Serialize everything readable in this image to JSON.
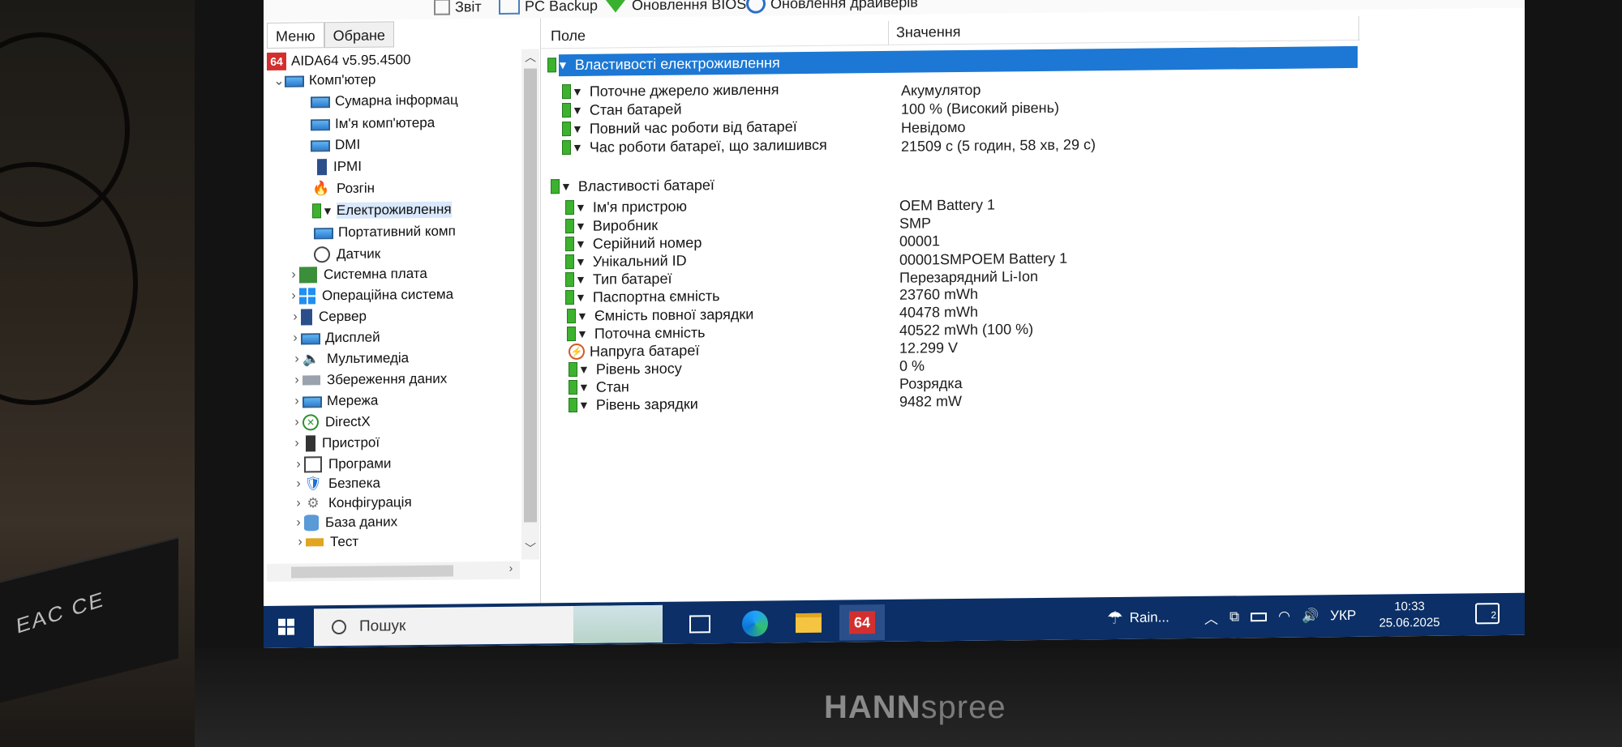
{
  "toolbar": {
    "report": "Звіт",
    "pc_backup": "PC Backup",
    "bios_update": "Оновлення BIOS",
    "driver_update": "Оновлення драйверів"
  },
  "left_pane": {
    "tabs": [
      "Меню",
      "Обране"
    ],
    "app_version": "AIDA64 v5.95.4500",
    "computer": "Комп'ютер",
    "computer_children": [
      "Сумарна інформац",
      "Ім'я комп'ютера",
      "DMI",
      "IPMI",
      "Розгін",
      "Електроживлення",
      "Портативний комп",
      "Датчик"
    ],
    "top_level": [
      "Системна плата",
      "Операційна система",
      "Сервер",
      "Дисплей",
      "Мультимедіа",
      "Збереження даних",
      "Мережа",
      "DirectX",
      "Пристрої",
      "Програми",
      "Безпека",
      "Конфігурація",
      "База даних",
      "Тест"
    ],
    "selected": "Електроживлення"
  },
  "right_pane": {
    "col_field": "Поле",
    "col_value": "Значення",
    "power_section": "Властивості електроживлення",
    "power_rows": [
      {
        "field": "Поточне джерело живлення",
        "value": "Акумулятор"
      },
      {
        "field": "Стан батарей",
        "value": "100 % (Високий рівень)"
      },
      {
        "field": "Повний час роботи від батареї",
        "value": "Невідомо"
      },
      {
        "field": "Час роботи батареї, що залишився",
        "value": "21509 с (5 годин, 58 хв, 29 с)"
      }
    ],
    "battery_section": "Властивості батареї",
    "battery_rows": [
      {
        "field": "Ім'я пристрою",
        "value": "OEM Battery 1"
      },
      {
        "field": "Виробник",
        "value": "SMP"
      },
      {
        "field": "Серійний номер",
        "value": "00001"
      },
      {
        "field": "Унікальний ID",
        "value": "00001SMPOEM Battery 1"
      },
      {
        "field": "Тип батареї",
        "value": "Перезарядний Li-Ion"
      },
      {
        "field": "Паспортна ємність",
        "value": "23760 mWh"
      },
      {
        "field": "Ємність повної зарядки",
        "value": "40478 mWh"
      },
      {
        "field": "Поточна ємність",
        "value": "40522 mWh  (100 %)"
      },
      {
        "field": "Напруга батареї",
        "value": "12.299 V"
      },
      {
        "field": "Рівень зносу",
        "value": "0 %"
      },
      {
        "field": "Стан",
        "value": "Розрядка"
      },
      {
        "field": "Рівень зарядки",
        "value": "9482 mW"
      }
    ]
  },
  "taskbar": {
    "search_placeholder": "Пошук",
    "aida_badge": "64",
    "weather": "Rain...",
    "language": "УКР",
    "time": "10:33",
    "date": "25.06.2025",
    "notifications": "2"
  },
  "monitor_brand": {
    "bold": "HANN",
    "rest": "spree"
  },
  "device_label": "EAC CE",
  "colors": {
    "selection": "#1c78d4",
    "taskbar": "#0b2f66",
    "battery_green": "#3cb22f",
    "aida_red": "#d32f2f"
  }
}
